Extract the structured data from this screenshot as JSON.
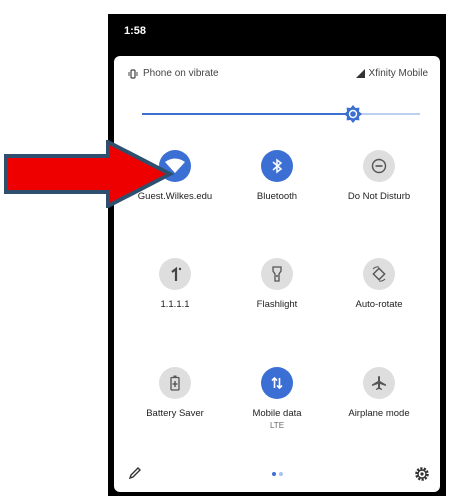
{
  "status": {
    "time": "1:58"
  },
  "info": {
    "ringer": "Phone on vibrate",
    "carrier": "Xfinity Mobile"
  },
  "brightness": {
    "level": 0.76
  },
  "tiles": [
    {
      "label": "Guest.Wilkes.edu",
      "icon": "wifi-icon",
      "state": "on"
    },
    {
      "label": "Bluetooth",
      "icon": "bluetooth-icon",
      "state": "on"
    },
    {
      "label": "Do Not Disturb",
      "icon": "do-not-disturb-icon",
      "state": "off"
    },
    {
      "label": "1.1.1.1",
      "icon": "vpn-icon",
      "state": "off"
    },
    {
      "label": "Flashlight",
      "icon": "flashlight-icon",
      "state": "off"
    },
    {
      "label": "Auto-rotate",
      "icon": "auto-rotate-icon",
      "state": "off"
    },
    {
      "label": "Battery Saver",
      "icon": "battery-saver-icon",
      "state": "off"
    },
    {
      "label": "Mobile data",
      "sublabel": "LTE",
      "icon": "mobile-data-icon",
      "state": "on"
    },
    {
      "label": "Airplane mode",
      "icon": "airplane-icon",
      "state": "off"
    }
  ],
  "pager": {
    "pages": 2,
    "current": 1
  },
  "colors": {
    "accent": "#3b6fd3",
    "tile_off": "#dedede",
    "arrow_fill": "#ee0000",
    "arrow_border": "#2f4f6f"
  }
}
